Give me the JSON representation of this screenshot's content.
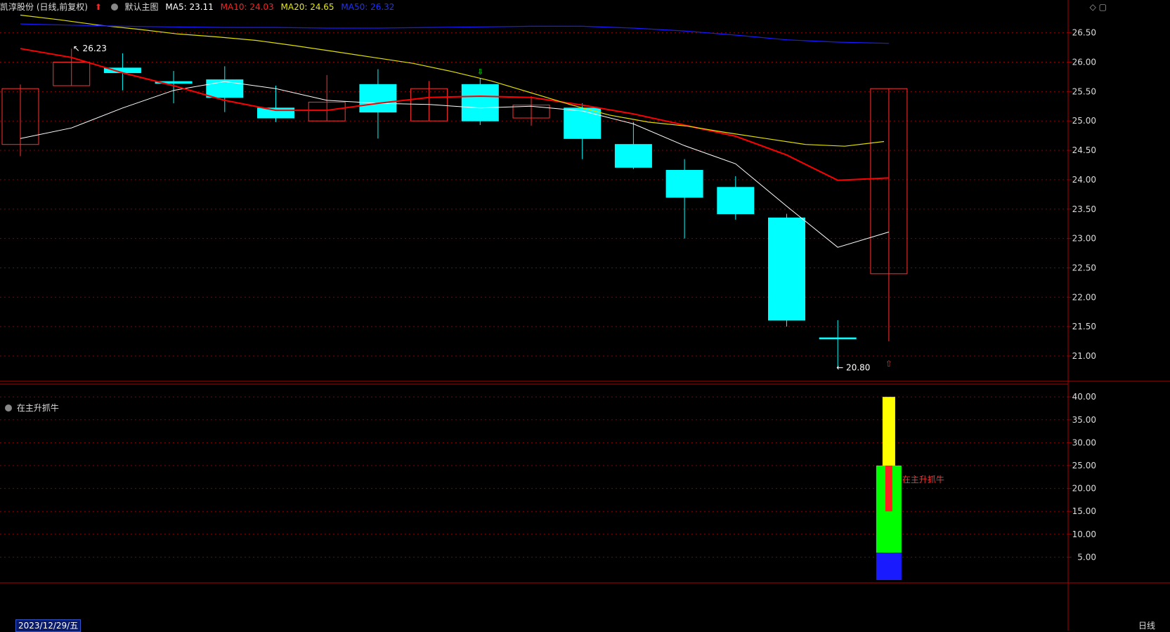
{
  "header": {
    "stock_name": "凯淳股份 (日线,前复权)",
    "template": "默认主图",
    "ma5": "MA5: 23.11",
    "ma10": "MA10: 24.03",
    "ma20": "MA20: 24.65",
    "ma50": "MA50: 26.32"
  },
  "indicator_pane": {
    "title": "在主升抓牛",
    "marker_label": "在主升抓牛"
  },
  "status_bar": {
    "date": "2023/12/29/五",
    "period": "日线"
  },
  "colors": {
    "up": "#ff3030",
    "down": "#00ffff",
    "ma5": "#ffffff",
    "ma10": "#ff0000",
    "ma20": "#e0e000",
    "ma50": "#1a1aff",
    "grid": "#8b0000",
    "axis_text": "#dddddd"
  },
  "chart_data": [
    {
      "type": "candlestick",
      "title": "",
      "ylim": [
        20.5,
        26.8
      ],
      "y_ticks": [
        "21.00",
        "21.50",
        "22.00",
        "22.50",
        "23.00",
        "23.50",
        "24.00",
        "24.50",
        "25.00",
        "25.50",
        "26.00",
        "26.50"
      ],
      "candles": [
        {
          "open": 24.6,
          "close": 25.55,
          "high": 25.62,
          "low": 24.4
        },
        {
          "open": 25.6,
          "close": 26.0,
          "high": 26.23,
          "low": 25.6
        },
        {
          "open": 25.9,
          "close": 25.82,
          "high": 26.15,
          "low": 25.52
        },
        {
          "open": 25.67,
          "close": 25.64,
          "high": 25.85,
          "low": 25.3
        },
        {
          "open": 25.7,
          "close": 25.4,
          "high": 25.93,
          "low": 25.15
        },
        {
          "open": 25.22,
          "close": 25.05,
          "high": 25.6,
          "low": 24.98
        },
        {
          "open": 25.0,
          "close": 25.32,
          "high": 25.78,
          "low": 25.0
        },
        {
          "open": 25.62,
          "close": 25.15,
          "high": 25.88,
          "low": 24.7
        },
        {
          "open": 25.0,
          "close": 25.55,
          "high": 25.68,
          "low": 25.0
        },
        {
          "open": 25.62,
          "close": 25.0,
          "high": 25.72,
          "low": 24.93
        },
        {
          "open": 25.05,
          "close": 25.27,
          "high": 25.42,
          "low": 24.92
        },
        {
          "open": 25.22,
          "close": 24.7,
          "high": 25.3,
          "low": 24.35
        },
        {
          "open": 24.6,
          "close": 24.21,
          "high": 24.98,
          "low": 24.18
        },
        {
          "open": 24.16,
          "close": 23.7,
          "high": 24.35,
          "low": 23.0
        },
        {
          "open": 23.87,
          "close": 23.42,
          "high": 24.06,
          "low": 23.32
        },
        {
          "open": 23.35,
          "close": 21.61,
          "high": 23.42,
          "low": 21.5
        },
        {
          "open": 21.31,
          "close": 21.3,
          "high": 21.61,
          "low": 20.8
        },
        {
          "open": 22.4,
          "close": 25.55,
          "high": 25.55,
          "low": 21.25
        }
      ],
      "annotations": [
        {
          "text": "26.23",
          "type": "high"
        },
        {
          "text": "20.80",
          "type": "low"
        }
      ],
      "series": [
        {
          "name": "MA5",
          "values": [
            24.7,
            24.88,
            25.22,
            25.52,
            25.67,
            25.55,
            25.35,
            25.3,
            25.28,
            25.22,
            25.25,
            25.17,
            24.95,
            24.58,
            24.27,
            23.55,
            22.85,
            23.11
          ]
        },
        {
          "name": "MA10",
          "values": [
            26.23,
            26.08,
            25.82,
            25.6,
            25.35,
            25.18,
            25.18,
            25.3,
            25.4,
            25.42,
            25.4,
            25.27,
            25.12,
            24.93,
            24.74,
            24.42,
            23.99,
            24.03
          ]
        },
        {
          "name": "MA20",
          "values": [
            26.8,
            26.72,
            26.63,
            26.56,
            26.48,
            26.43,
            26.37,
            26.28,
            26.18,
            26.08,
            25.98,
            25.84,
            25.68,
            25.48,
            25.28,
            25.1,
            24.98,
            24.91,
            24.8,
            24.7,
            24.6,
            24.57,
            24.65
          ]
        },
        {
          "name": "MA50",
          "values": [
            26.65,
            26.63,
            26.61,
            26.6,
            26.59,
            26.59,
            26.58,
            26.58,
            26.59,
            26.6,
            26.61,
            26.61,
            26.58,
            26.53,
            26.46,
            26.38,
            26.34,
            26.32
          ]
        }
      ]
    },
    {
      "type": "bar",
      "title": "在主升抓牛",
      "ylim": [
        0,
        42
      ],
      "y_ticks": [
        "5.00",
        "10.00",
        "15.00",
        "20.00",
        "25.00",
        "30.00",
        "35.00",
        "40.00"
      ],
      "stacked_bar": {
        "index": 17,
        "segments": [
          {
            "from": 0,
            "to": 10,
            "color": "#1a1aff"
          },
          {
            "from": 6,
            "to": 25,
            "color": "#00ff00"
          },
          {
            "from": 25,
            "to": 40,
            "color": "#ffff00"
          },
          {
            "from": 15,
            "to": 25,
            "color": "#ff2020"
          }
        ]
      }
    }
  ]
}
